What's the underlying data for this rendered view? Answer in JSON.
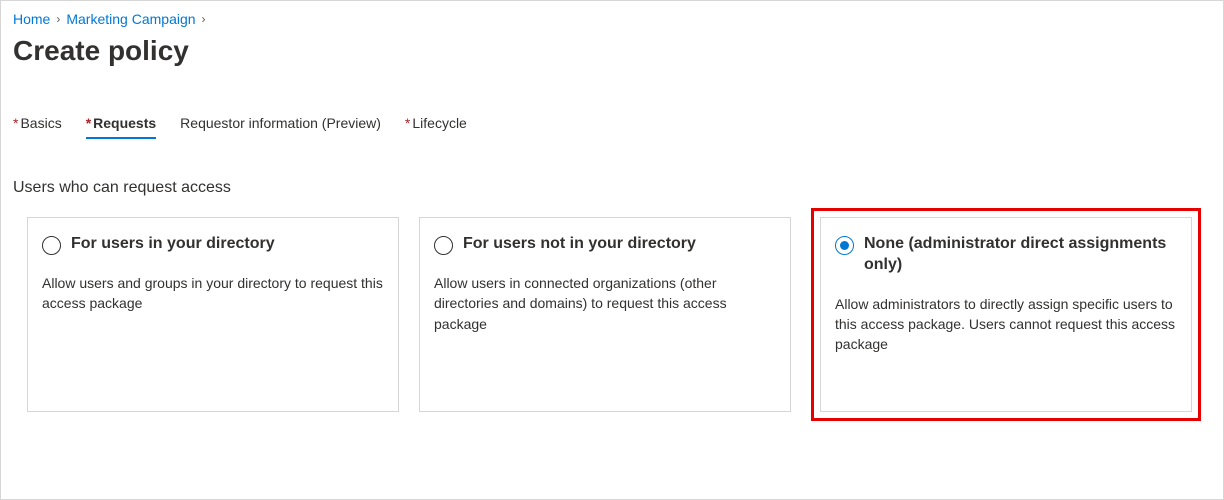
{
  "breadcrumb": {
    "items": [
      {
        "label": "Home"
      },
      {
        "label": "Marketing Campaign"
      }
    ]
  },
  "page": {
    "title": "Create policy"
  },
  "tabs": [
    {
      "label": "Basics",
      "required": true,
      "active": false
    },
    {
      "label": "Requests",
      "required": true,
      "active": true
    },
    {
      "label": "Requestor information (Preview)",
      "required": false,
      "active": false
    },
    {
      "label": "Lifecycle",
      "required": true,
      "active": false
    }
  ],
  "section": {
    "heading": "Users who can request access"
  },
  "cards": [
    {
      "title": "For users in your directory",
      "desc": "Allow users and groups in your directory to request this access package",
      "selected": false
    },
    {
      "title": "For users not in your directory",
      "desc": "Allow users in connected organizations (other directories and domains) to request this access package",
      "selected": false
    },
    {
      "title": "None (administrator direct assignments only)",
      "desc": "Allow administrators to directly assign specific users to this access package. Users cannot request this access package",
      "selected": true
    }
  ],
  "req_marker": "*"
}
